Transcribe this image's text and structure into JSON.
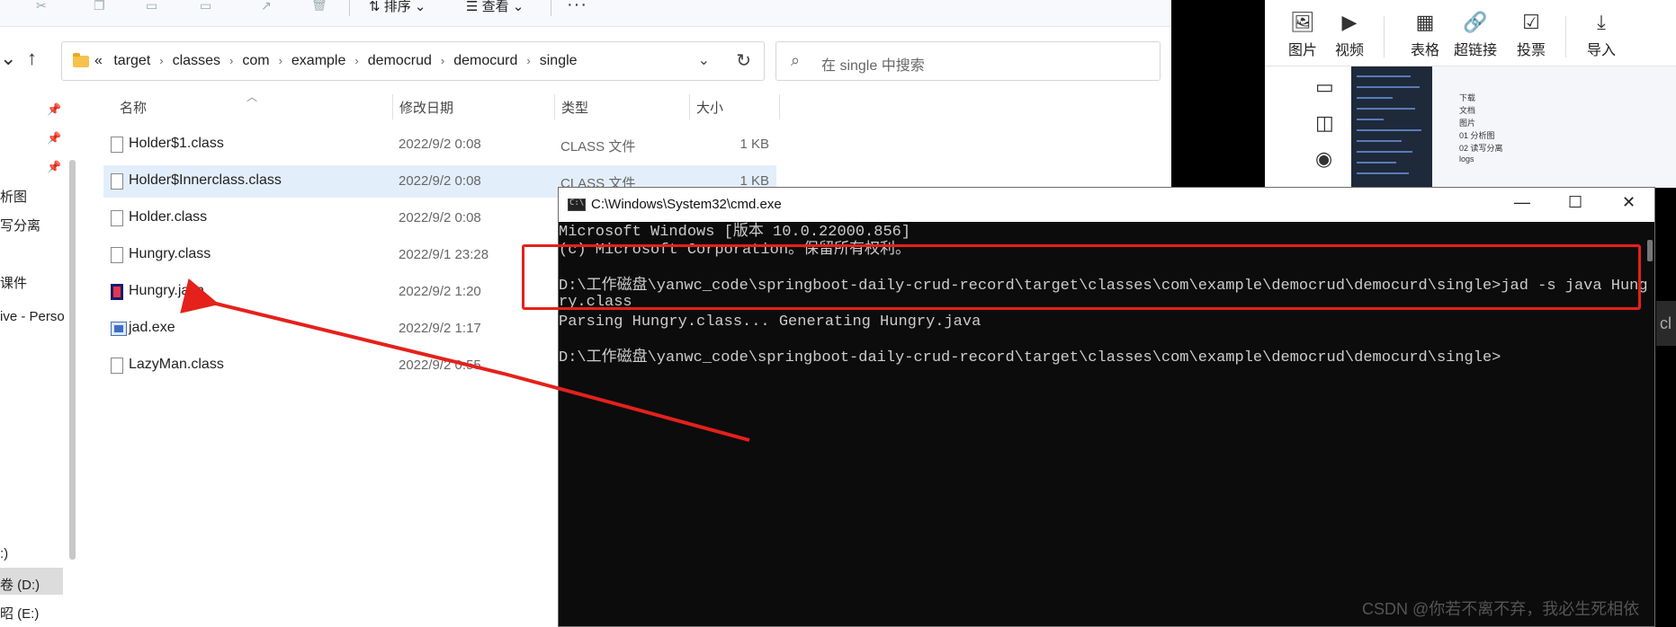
{
  "explorer": {
    "toolbar": {
      "sort_label": "排序",
      "view_label": "查看",
      "more_label": "···"
    },
    "address": {
      "overflow": "«",
      "crumbs": [
        "target",
        "classes",
        "com",
        "example",
        "democrud",
        "democurd",
        "single"
      ]
    },
    "search": {
      "placeholder": "在 single 中搜索"
    },
    "sidebar": {
      "items": [
        "析图",
        "写分离",
        "课件",
        "ive - Perso",
        ":)",
        "卷 (D:)",
        "昭 (E:)"
      ]
    },
    "columns": {
      "name": "名称",
      "date": "修改日期",
      "type": "类型",
      "size": "大小"
    },
    "files": [
      {
        "name": "Holder$1.class",
        "date": "2022/9/2 0:08",
        "type": "CLASS 文件",
        "size": "1 KB"
      },
      {
        "name": "Holder$Innerclass.class",
        "date": "2022/9/2 0:08",
        "type": "CLASS 文件",
        "size": "1 KB"
      },
      {
        "name": "Holder.class",
        "date": "2022/9/2 0:08",
        "type": "",
        "size": ""
      },
      {
        "name": "Hungry.class",
        "date": "2022/9/1 23:28",
        "type": "",
        "size": ""
      },
      {
        "name": "Hungry.java",
        "date": "2022/9/2 1:20",
        "type": "",
        "size": ""
      },
      {
        "name": "jad.exe",
        "date": "2022/9/2 1:17",
        "type": "",
        "size": ""
      },
      {
        "name": "LazyMan.class",
        "date": "2022/9/2 0:55",
        "type": "",
        "size": ""
      }
    ]
  },
  "editor": {
    "ribbon": {
      "picture": "图片",
      "video": "视频",
      "table": "表格",
      "hyperlink": "超链接",
      "vote": "投票",
      "import": "导入"
    },
    "dark_tab_text": "cl",
    "thumb_items": [
      "下载",
      "文档",
      "图片",
      "01 分析图",
      "02 读写分离",
      "logs"
    ]
  },
  "cmd": {
    "title": "C:\\Windows\\System32\\cmd.exe",
    "lines": [
      "Microsoft Windows [版本 10.0.22000.856]",
      "(c) Microsoft Corporation。保留所有权利。",
      "",
      "D:\\工作磁盘\\yanwc_code\\springboot-daily-crud-record\\target\\classes\\com\\example\\democrud\\democurd\\single>jad -s java Hung",
      "ry.class",
      "Parsing Hungry.class... Generating Hungry.java",
      "",
      "D:\\工作磁盘\\yanwc_code\\springboot-daily-crud-record\\target\\classes\\com\\example\\democrud\\democurd\\single>"
    ]
  },
  "watermark": "CSDN @你若不离不弃，我必生死相依",
  "colors": {
    "annotation_red": "#e4211b",
    "selection_blue": "#e3eefb",
    "cmd_bg": "#0c0c0c"
  }
}
